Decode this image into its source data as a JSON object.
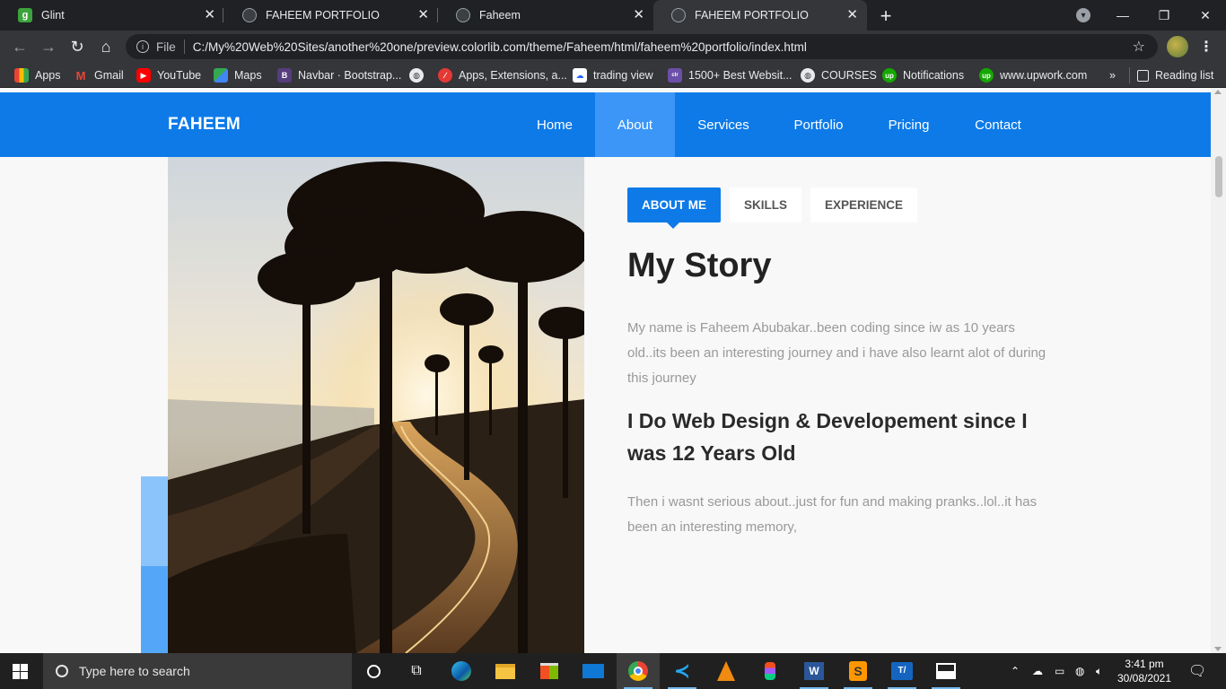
{
  "browser": {
    "tabs": [
      {
        "title": "Glint",
        "favicon": "glint-icon"
      },
      {
        "title": "FAHEEM PORTFOLIO",
        "favicon": "globe-icon"
      },
      {
        "title": "Faheem",
        "favicon": "globe-icon"
      },
      {
        "title": "FAHEEM PORTFOLIO",
        "favicon": "globe-icon",
        "active": true
      }
    ],
    "address": {
      "scheme_label": "File",
      "url": "C:/My%20Web%20Sites/another%20one/preview.colorlib.com/theme/Faheem/html/faheem%20portfolio/index.html"
    },
    "bookmarks": [
      {
        "label": "Apps",
        "icon": "apps-grid-icon"
      },
      {
        "label": "Gmail",
        "icon": "gmail-icon"
      },
      {
        "label": "YouTube",
        "icon": "youtube-icon"
      },
      {
        "label": "Maps",
        "icon": "maps-icon"
      },
      {
        "label": "Navbar · Bootstrap...",
        "icon": "bootstrap-icon"
      },
      {
        "label": "",
        "icon": "globe-icon"
      },
      {
        "label": "Apps, Extensions, a...",
        "icon": "app-extension-icon"
      },
      {
        "label": "trading view",
        "icon": "tradingview-icon"
      },
      {
        "label": "1500+ Best Websit...",
        "icon": "colorlib-icon"
      },
      {
        "label": "COURSES",
        "icon": "globe-icon"
      },
      {
        "label": "Notifications",
        "icon": "upwork-icon"
      },
      {
        "label": "www.upwork.com",
        "icon": "upwork-icon"
      }
    ],
    "bookmarks_overflow": "»",
    "reading_list": "Reading list"
  },
  "site": {
    "brand": "FAHEEM",
    "nav": [
      "Home",
      "About",
      "Services",
      "Portfolio",
      "Pricing",
      "Contact"
    ],
    "active_nav": "About",
    "about_tabs": [
      "ABOUT ME",
      "SKILLS",
      "EXPERIENCE"
    ],
    "active_tab": "ABOUT ME",
    "title": "My Story",
    "paragraph1": "My name is Faheem Abubakar..been coding since iw as 10 years old..its been an interesting journey and i have also learnt alot of during this journey",
    "subheading": "I Do Web Design & Developement since I was 12 Years Old",
    "paragraph2": "Then i wasnt serious about..just for fun and making pranks..lol..it has been an interesting memory,",
    "colors": {
      "primary": "#0d7ae8",
      "nav_active": "#3b96f7",
      "accent_light": "#8ac4fb",
      "accent_mid": "#54a7f8"
    }
  },
  "taskbar": {
    "search_placeholder": "Type here to search",
    "apps": [
      "task-view-icon",
      "edge-icon",
      "file-explorer-icon",
      "store-icon",
      "mail-icon",
      "chrome-icon",
      "vscode-icon",
      "vlc-icon",
      "figma-icon",
      "word-icon",
      "sublime-icon",
      "typora-icon",
      "photos-icon"
    ],
    "time": "3:41 pm",
    "date": "30/08/2021"
  }
}
